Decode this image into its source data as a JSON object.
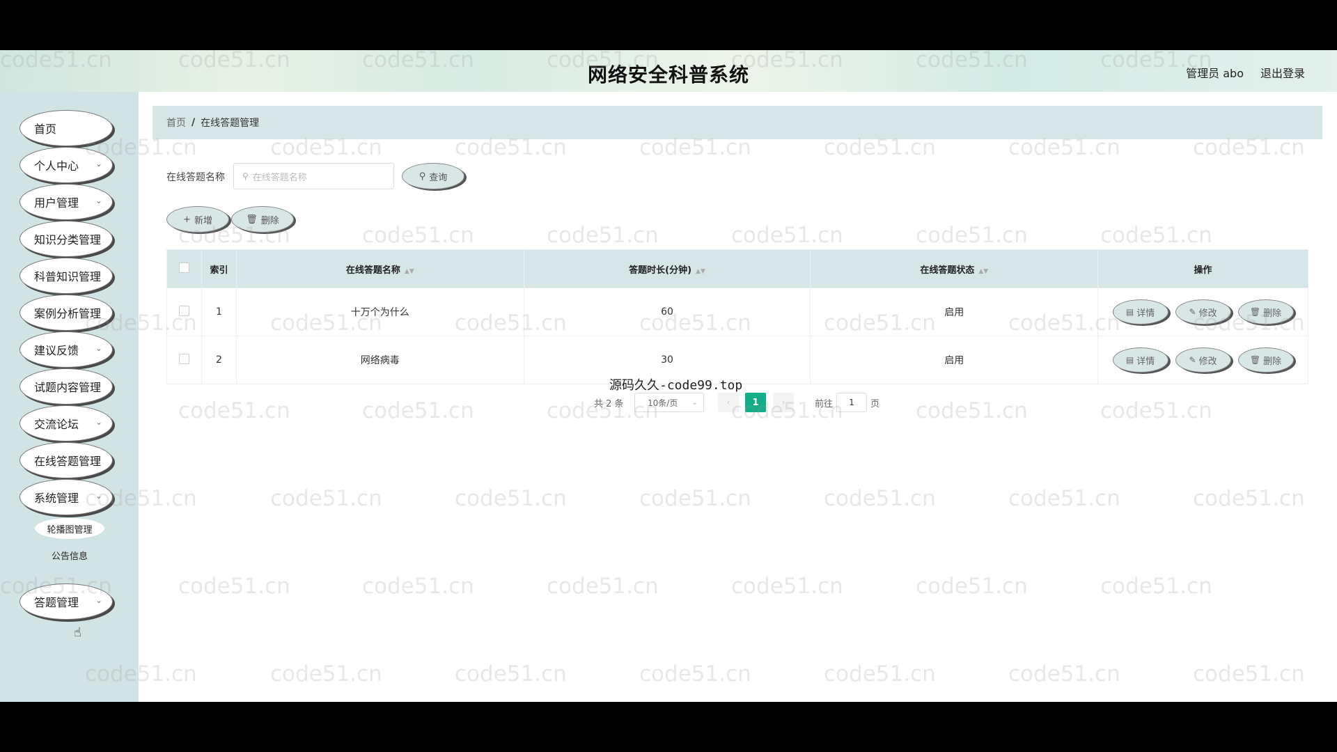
{
  "header": {
    "title": "网络安全科普系统",
    "user": "管理员 abo",
    "logout": "退出登录"
  },
  "sidebar": {
    "items": [
      {
        "label": "首页",
        "has_children": false
      },
      {
        "label": "个人中心",
        "has_children": true
      },
      {
        "label": "用户管理",
        "has_children": true
      },
      {
        "label": "知识分类管理",
        "has_children": false
      },
      {
        "label": "科普知识管理",
        "has_children": false
      },
      {
        "label": "案例分析管理",
        "has_children": false
      },
      {
        "label": "建议反馈",
        "has_children": true
      },
      {
        "label": "试题内容管理",
        "has_children": false
      },
      {
        "label": "交流论坛",
        "has_children": true
      },
      {
        "label": "在线答题管理",
        "has_children": false
      },
      {
        "label": "系统管理",
        "has_children": true
      },
      {
        "label": "答题管理",
        "has_children": true
      }
    ],
    "submenu": [
      {
        "label": "轮播图管理"
      },
      {
        "label": "公告信息"
      }
    ]
  },
  "breadcrumb": {
    "home": "首页",
    "separator": "/",
    "current": "在线答题管理"
  },
  "search": {
    "label": "在线答题名称",
    "placeholder": "在线答题名称",
    "query_button": "查询"
  },
  "toolbar": {
    "add_label": "新增",
    "delete_label": "删除"
  },
  "table": {
    "headers": [
      "索引",
      "在线答题名称",
      "答题时长(分钟)",
      "在线答题状态",
      "操作"
    ],
    "rows": [
      {
        "index": "1",
        "name": "十万个为什么",
        "duration": "60",
        "status": "启用"
      },
      {
        "index": "2",
        "name": "网络病毒",
        "duration": "30",
        "status": "启用"
      }
    ],
    "actions": {
      "detail": "详情",
      "edit": "修改",
      "delete": "删除"
    }
  },
  "pagination": {
    "total": "共 2 条",
    "page_size": "10条/页",
    "current_page": "1",
    "goto_label": "前往",
    "goto_value": "1",
    "page_unit": "页"
  },
  "overlay_text": "源码久久-code99.top",
  "watermark": "code51.cn",
  "colors": {
    "sidebar_bg": "#d2e3e4",
    "table_header_bg": "#d6e6e6",
    "accent": "#13ae87"
  }
}
